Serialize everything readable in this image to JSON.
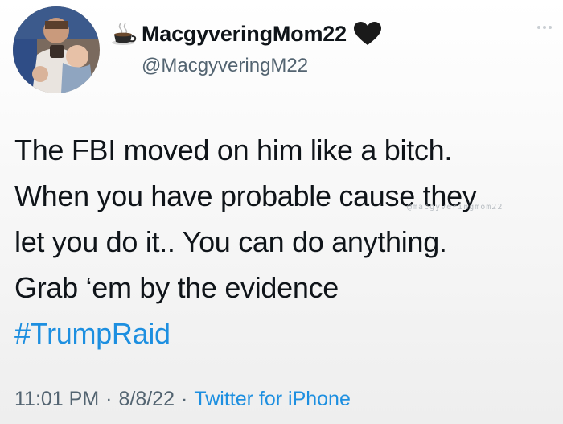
{
  "tweet": {
    "display_name": "MacgyveringMom22",
    "handle": "@MacgyveringM22",
    "name_prefix_icon": "coffee-cup-icon",
    "name_suffix_icon": "black-heart-icon",
    "body_lines": [
      "The FBI moved on him like a bitch.",
      "When you have probable cause they",
      "let you do it.. You can do anything.",
      "Grab ‘em by the evidence"
    ],
    "hashtag": "#TrumpRaid",
    "watermark": "@macgyveringmom22",
    "time": "11:01 PM",
    "date": "8/8/22",
    "separator": "·",
    "source": "Twitter for iPhone"
  },
  "colors": {
    "link": "#1d8fe0",
    "secondary_text": "#536471",
    "primary_text": "#0f1419"
  }
}
